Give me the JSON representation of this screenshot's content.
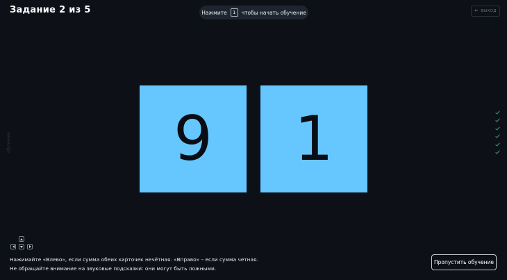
{
  "header": {
    "task_title": "Задание 2 из 5",
    "hint_prefix": "Нажмите",
    "hint_key": "1",
    "hint_suffix": "чтобы начать обучение",
    "exit_label": "ВЫХОД"
  },
  "side_label": "обучение",
  "cards": [
    {
      "value": "9"
    },
    {
      "value": "1"
    }
  ],
  "progress_checks": {
    "count": 6,
    "icon": "check-icon",
    "color": "#3a8f6e"
  },
  "keys": {
    "up": "arrow-up-icon",
    "left": "arrow-left-icon",
    "down": "arrow-down-icon",
    "right": "arrow-right-icon"
  },
  "instructions": {
    "line1": "Нажимайте «Влево», если сумма обеих карточек нечётная. «Вправо» – если сумма четная.",
    "line2": "Не обращайте внимание на звуковые подсказки: они могут быть ложными."
  },
  "skip_button": "Пропустить обучение",
  "colors": {
    "background": "#0d1117",
    "card": "#66c7ff",
    "pill": "#1e2530"
  }
}
